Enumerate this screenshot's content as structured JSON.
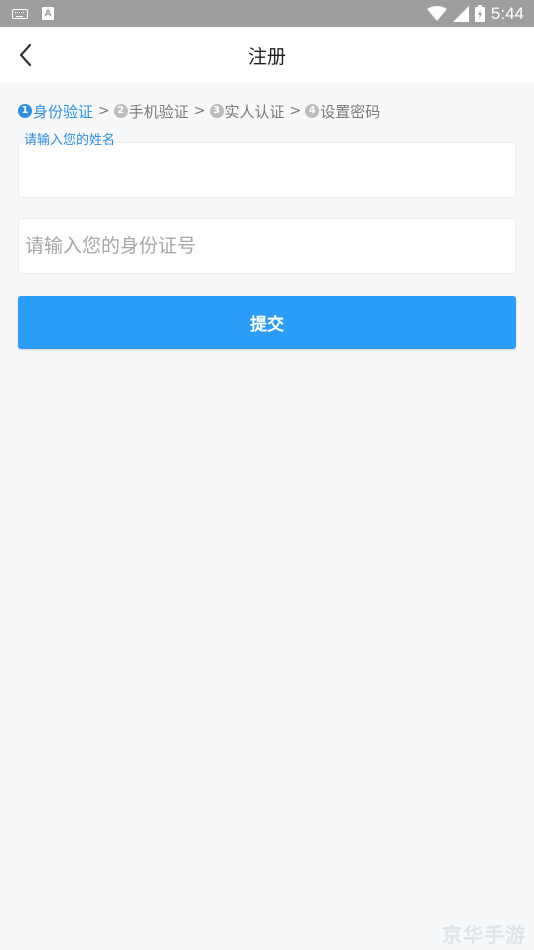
{
  "status_bar": {
    "time": "5:44",
    "icons": [
      "keyboard-icon",
      "a-notification-icon",
      "wifi-icon",
      "signal-icon",
      "battery-icon"
    ]
  },
  "header": {
    "back_icon": "chevron-left-icon",
    "title": "注册"
  },
  "steps": [
    {
      "num": "1",
      "label": "身份验证",
      "active": true
    },
    {
      "num": "2",
      "label": "手机验证",
      "active": false
    },
    {
      "num": "3",
      "label": "实人认证",
      "active": false
    },
    {
      "num": "4",
      "label": "设置密码",
      "active": false
    }
  ],
  "step_separator": ">",
  "form": {
    "name_label": "请输入您的姓名",
    "name_value": "",
    "id_placeholder": "请输入您的身份证号",
    "id_value": "",
    "submit_label": "提交"
  },
  "watermark": "京华手游",
  "colors": {
    "accent": "#2e8fe0",
    "button": "#2b9cf7",
    "background": "#f7f8fa",
    "status_bar": "#9e9e9e"
  }
}
